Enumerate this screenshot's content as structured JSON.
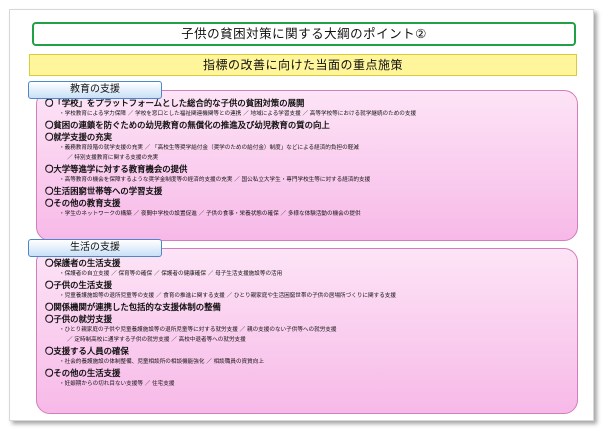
{
  "title": "子供の貧困対策に関する大綱のポイント②",
  "subtitle": "指標の改善に向けた当面の重点施策",
  "sections": [
    {
      "label": "教育の支援",
      "lines": [
        {
          "kind": "head",
          "text": "〇「学校」をプラットフォームとした総合的な子供の貧困対策の展開"
        },
        {
          "kind": "sub",
          "text": "・学校教育による学力保障 ／ 学校を窓口とした福祉関連機関等との連携 ／ 地域による学習支援 ／ 高等学校等における就学継続のための支援"
        },
        {
          "kind": "head",
          "text": "〇貧困の連鎖を防ぐための幼児教育の無償化の推進及び幼児教育の質の向上"
        },
        {
          "kind": "head",
          "text": "〇就学支援の充実"
        },
        {
          "kind": "sub",
          "text": "・義務教育段階の就学支援の充実 ／ 「高校生等奨学給付金（奨学のための給付金）制度」などによる経済的負担の軽減"
        },
        {
          "kind": "sub2",
          "text": "／ 特別支援教育に関する支援の充実"
        },
        {
          "kind": "head",
          "text": "〇大学等進学に対する教育機会の提供"
        },
        {
          "kind": "sub",
          "text": "・高等教育の機会を保障するような奨学金制度等の経済的支援の充実 ／ 国公私立大学生・専門学校生等に対する経済的支援"
        },
        {
          "kind": "head",
          "text": "〇生活困窮世帯等への学習支援"
        },
        {
          "kind": "head",
          "text": "〇その他の教育支援"
        },
        {
          "kind": "sub",
          "text": "・学生のネットワークの構築 ／ 夜間中学校の設置促進 ／ 子供の食事・栄養状態の確保 ／ 多様な体験活動の機会の提供"
        }
      ]
    },
    {
      "label": "生活の支援",
      "lines": [
        {
          "kind": "head",
          "text": "〇保護者の生活支援"
        },
        {
          "kind": "sub",
          "text": "・保護者の自立支援 ／ 保育等の確保 ／ 保護者の健康確保 ／ 母子生活支援施設等の活用"
        },
        {
          "kind": "head",
          "text": "〇子供の生活支援"
        },
        {
          "kind": "sub",
          "text": "・児童養護施設等の退所児童等の支援 ／ 食育の推進に関する支援 ／ ひとり親家庭や生活困窮世帯の子供の居場所づくりに関する支援"
        },
        {
          "kind": "head",
          "text": "〇関係機関が連携した包括的な支援体制の整備"
        },
        {
          "kind": "head",
          "text": "〇子供の就労支援"
        },
        {
          "kind": "sub",
          "text": "・ひとり親家庭の子供や児童養護施設等の退所児童等に対する就労支援 ／ 親の支援のない子供等への就労支援"
        },
        {
          "kind": "sub2",
          "text": "／ 定時制高校に通学する子供の就労支援 ／ 高校中退者等への就労支援"
        },
        {
          "kind": "head",
          "text": "〇支援する人員の確保"
        },
        {
          "kind": "sub",
          "text": "・社会的養護施設の体制整備、児童相談所の相談機能強化 ／ 相談職員の資質向上"
        },
        {
          "kind": "head",
          "text": "〇その他の生活支援"
        },
        {
          "kind": "sub",
          "text": "・妊娠期からの切れ目ない支援等 ／ 住宅支援"
        }
      ]
    }
  ]
}
